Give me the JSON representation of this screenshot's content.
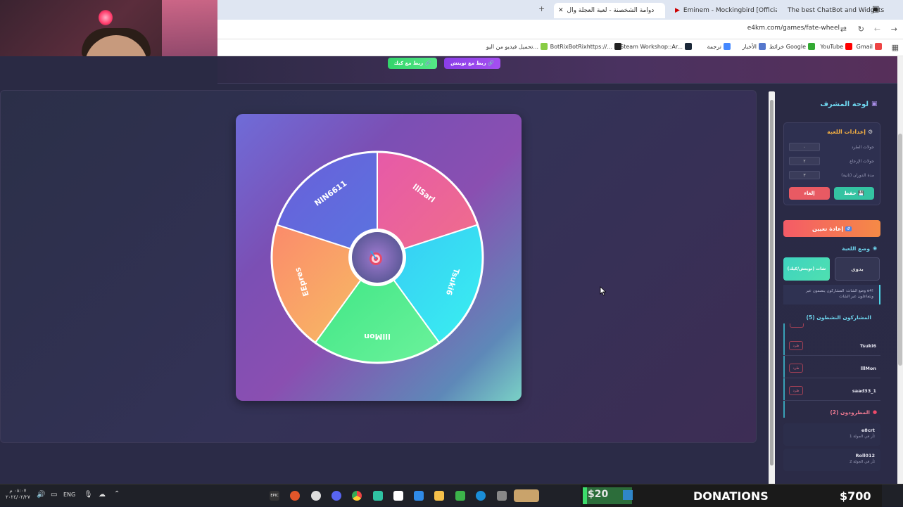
{
  "browser": {
    "tabs": [
      {
        "label": "The best ChatBot and Widgets",
        "active": false
      },
      {
        "label": "Eminem - Mockingbird [Officia",
        "active": false
      },
      {
        "label": "دوامة الشخصنة - لعبة العجلة وال",
        "active": true
      }
    ],
    "url": "e4km.com/games/fate-wheel",
    "bookmarks": [
      "Gmail",
      "YouTube",
      "خرائط Google",
      "الأخبار",
      "ترجمة",
      "Steam Workshop::Ar...",
      "BotRixBotRixhttps://...",
      "تحميل فيديو من اليو..."
    ]
  },
  "topbar": {
    "twitch_label": "ربط مع تويتش",
    "kick_label": "ربط مع كيك"
  },
  "wheel": {
    "segments": [
      {
        "label": "lllSarl",
        "color_a": "#e65aa8",
        "color_b": "#f06e8a"
      },
      {
        "label": "Tsuki6",
        "color_a": "#36c9f5",
        "color_b": "#3af0f0"
      },
      {
        "label": "lllMon",
        "color_a": "#3be584",
        "color_b": "#6cf29b"
      },
      {
        "label": "EEpres",
        "color_a": "#fb8a6b",
        "color_b": "#f7c063"
      },
      {
        "label": "NIN6611",
        "color_a": "#6a5fd9",
        "color_b": "#5a74e0"
      }
    ],
    "center_icon": "target-icon"
  },
  "sidebar": {
    "title": "لوحة المشرف",
    "settings": {
      "title": "إعدادات اللعبة",
      "fields": [
        {
          "label": "جولات الطرد",
          "value": "٠"
        },
        {
          "label": "جولات الإرجاع",
          "value": "٢"
        },
        {
          "label": "مدة الدوران (ثانية)",
          "value": "٣"
        }
      ],
      "save_label": "حفظ",
      "cancel_label": "إلغاء"
    },
    "reset_label": "إعادة تعيين",
    "mode": {
      "title": "وضع اللعبة",
      "manual_label": "يدوي",
      "chat_label": "شات (تويتش/كيك)",
      "hint": "وضع الشات: المشاركون ينضمون عبر e4! ويتفاعلون عبر الشات"
    },
    "active_title": "المشاركون النشطون (5)",
    "active": [
      {
        "name": "Tsuki6",
        "kick": "طرد"
      },
      {
        "name": "lllMon",
        "kick": "طرد"
      },
      {
        "name": "saad33_1",
        "kick": "طرد"
      }
    ],
    "eliminated_title": "المطرودون (2)",
    "eliminated": [
      {
        "name": "e8crt",
        "note": "ثأر في الجولة 1"
      },
      {
        "name": "Roll012",
        "note": "ثأر في الجولة 2"
      }
    ]
  },
  "taskbar": {
    "time": "٠٨:٠٧ م",
    "date": "٢٠٢٤/٠٢/٢٧",
    "lang": "ENG",
    "donation_small": "$20",
    "donation_label": "DONATIONS",
    "donation_total": "$700"
  }
}
